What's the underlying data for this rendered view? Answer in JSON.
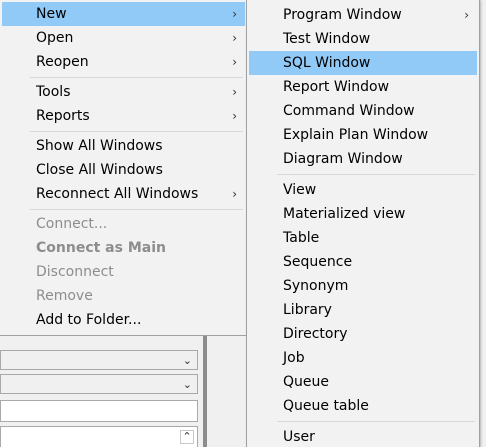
{
  "main_menu": {
    "groups": [
      [
        {
          "label": "New",
          "submenu": true,
          "highlighted": true
        },
        {
          "label": "Open",
          "submenu": true
        },
        {
          "label": "Reopen",
          "submenu": true
        }
      ],
      [
        {
          "label": "Tools",
          "submenu": true
        },
        {
          "label": "Reports",
          "submenu": true
        }
      ],
      [
        {
          "label": "Show All Windows"
        },
        {
          "label": "Close All Windows"
        },
        {
          "label": "Reconnect All Windows",
          "submenu": true
        }
      ],
      [
        {
          "label": "Connect...",
          "disabled": true
        },
        {
          "label": "Connect as Main",
          "disabled": true,
          "bold": true
        },
        {
          "label": "Disconnect",
          "disabled": true
        },
        {
          "label": "Remove",
          "disabled": true
        },
        {
          "label": "Add to Folder..."
        }
      ]
    ]
  },
  "new_submenu": {
    "groups": [
      [
        {
          "label": "Program Window",
          "submenu": true
        },
        {
          "label": "Test Window"
        },
        {
          "label": "SQL Window",
          "highlighted": true
        },
        {
          "label": "Report Window"
        },
        {
          "label": "Command Window"
        },
        {
          "label": "Explain Plan Window"
        },
        {
          "label": "Diagram Window"
        }
      ],
      [
        {
          "label": "View"
        },
        {
          "label": "Materialized view"
        },
        {
          "label": "Table"
        },
        {
          "label": "Sequence"
        },
        {
          "label": "Synonym"
        },
        {
          "label": "Library"
        },
        {
          "label": "Directory"
        },
        {
          "label": "Job"
        },
        {
          "label": "Queue"
        },
        {
          "label": "Queue table"
        }
      ],
      [
        {
          "label": "User"
        }
      ]
    ]
  },
  "icons": {
    "submenu_arrow": "chevron-right-icon",
    "combo_arrow": "chevron-down-icon",
    "scroll_arrow": "chevron-up-icon"
  },
  "colors": {
    "menu_background": "#f2f2f2",
    "highlight": "#91c9f7",
    "disabled_text": "#8d8d8d"
  }
}
